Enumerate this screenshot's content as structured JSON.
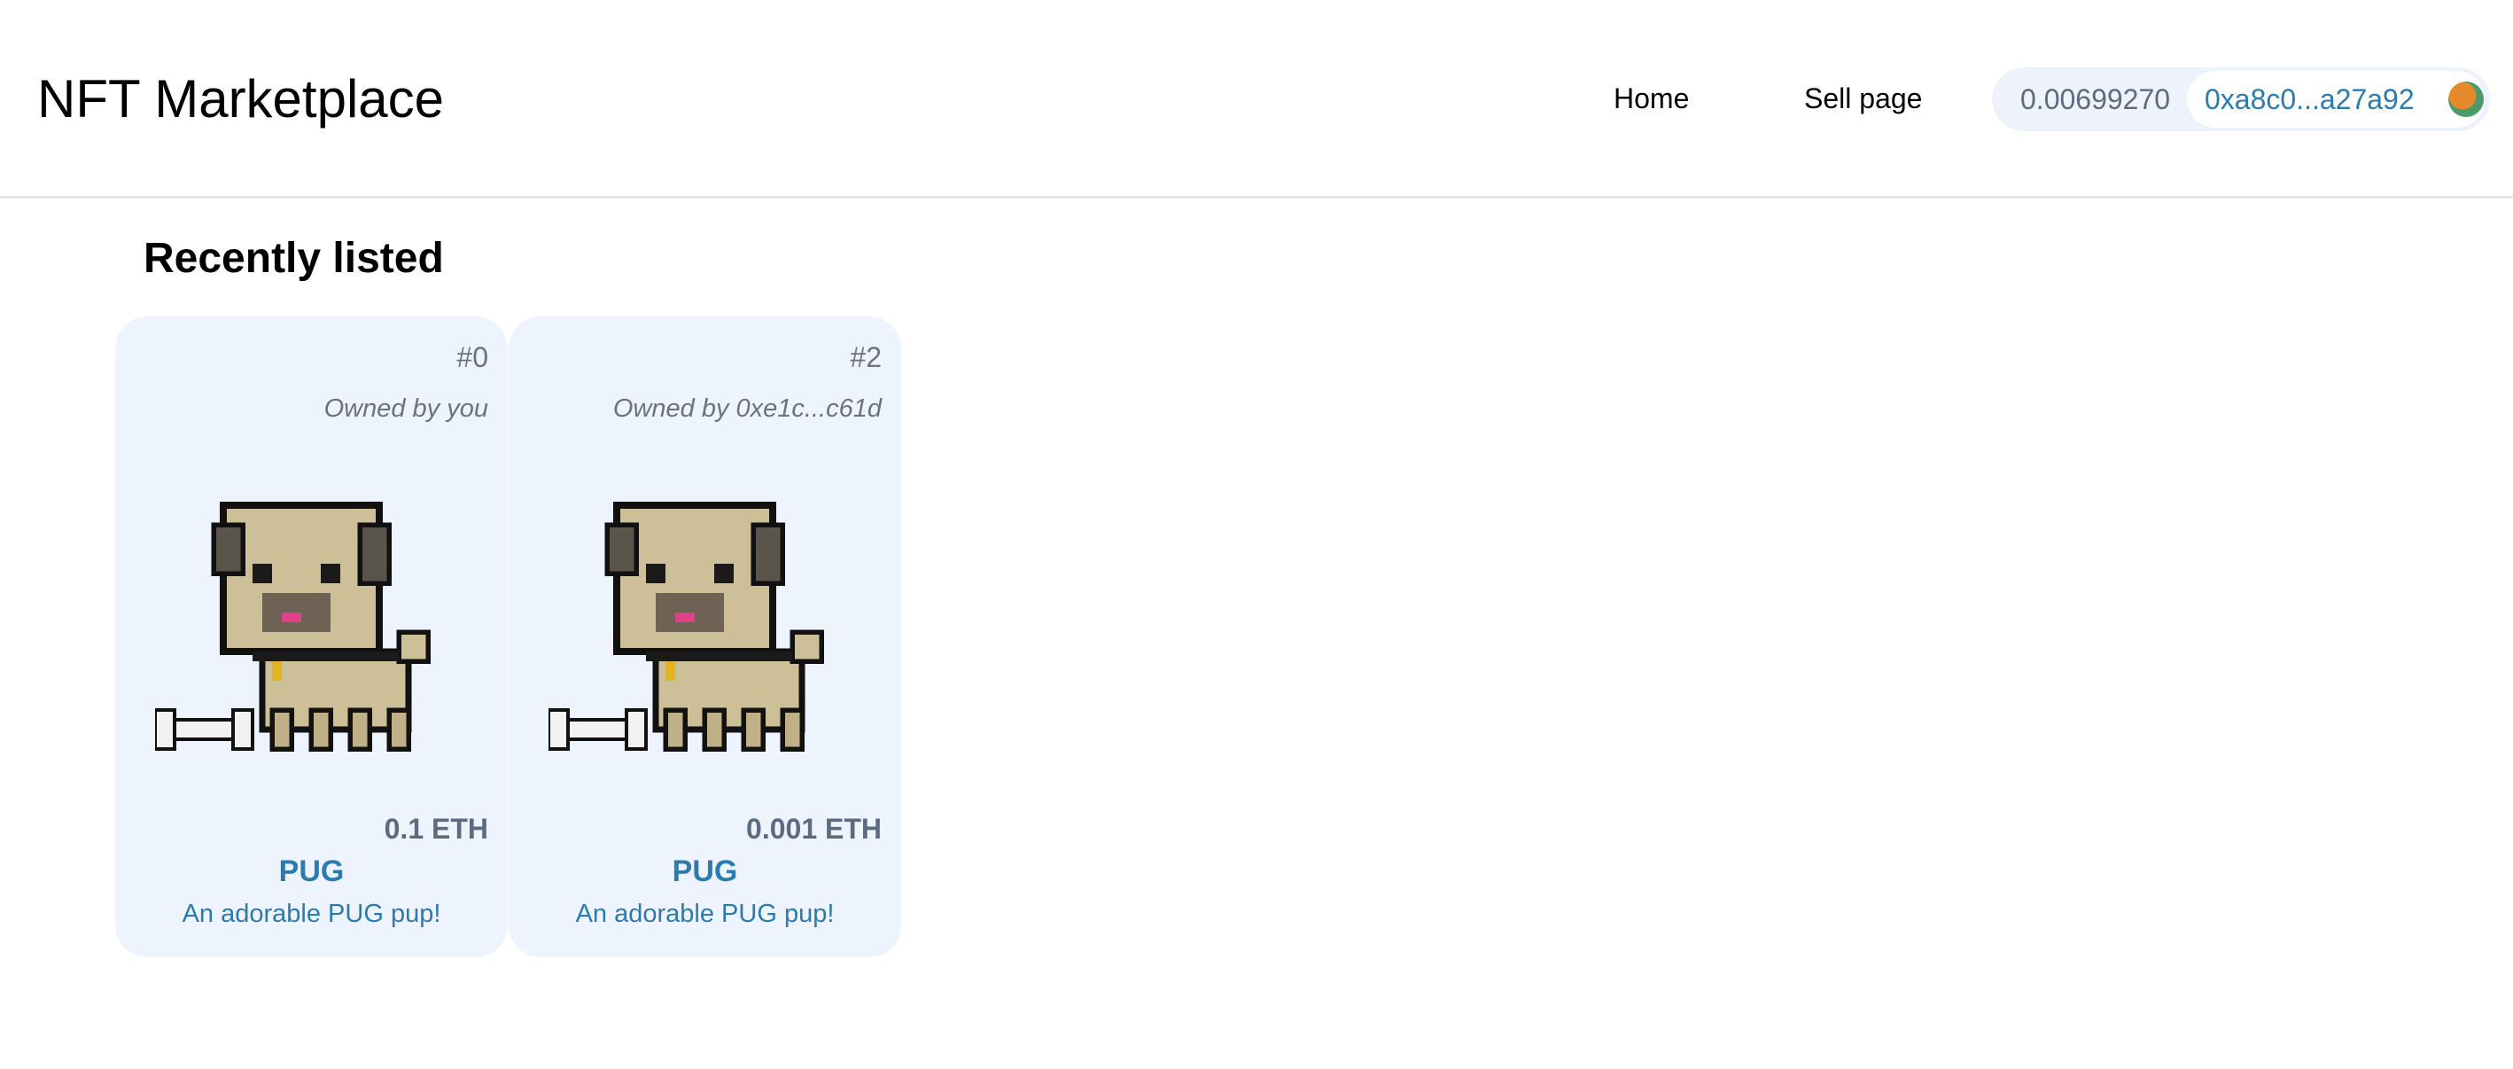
{
  "header": {
    "brand": "NFT Marketplace",
    "nav": [
      {
        "label": "Home"
      },
      {
        "label": "Sell page"
      }
    ],
    "wallet": {
      "balance": "0.00699270",
      "address": "0xa8c0...a27a92",
      "avatar_icon": "wallet-avatar-icon"
    }
  },
  "main": {
    "section_title": "Recently listed",
    "listings": [
      {
        "token_id": "#0",
        "owner": "Owned by you",
        "image_icon": "pug-pixel-art",
        "price": "0.1 ETH",
        "name": "PUG",
        "description": "An adorable PUG pup!"
      },
      {
        "token_id": "#2",
        "owner": "Owned by 0xe1c...c61d",
        "image_icon": "pug-pixel-art",
        "price": "0.001 ETH",
        "name": "PUG",
        "description": "An adorable PUG pup!"
      }
    ]
  },
  "colors": {
    "card_bg": "#eef4fe",
    "accent": "#2b7bb0",
    "muted": "#5c6b80"
  }
}
